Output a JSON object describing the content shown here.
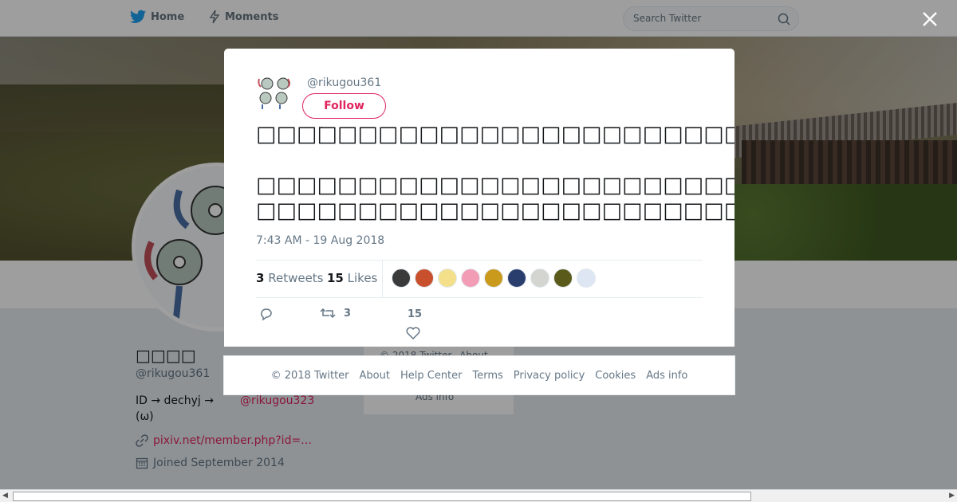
{
  "nav": {
    "home_label": "Home",
    "moments_label": "Moments",
    "search_placeholder": "Search Twitter"
  },
  "profile": {
    "name": "\u0000\u0000\u0000\u0000",
    "name_display": "□□□□",
    "handle": "@rikugou361",
    "bio_text": "ID → dechyj  →",
    "bio_second_line": "(ω)",
    "bio_mention": "@rikugou323",
    "link": "pixiv.net/member.php?id=…",
    "joined": "Joined September 2014"
  },
  "side_footer": {
    "copyright": "© 2018 Twitter",
    "about": "About",
    "ads_info": "Ads info"
  },
  "modal": {
    "handle": "@rikugou361",
    "follow_label": "Follow",
    "tweet_line1": "□□□□□□□□□□□□□□□□□□□□□□□□□□□□□□□□□□",
    "tweet_line2": "",
    "tweet_line3": "□□□□□□□□□□□□□□□□□□□□□□□□",
    "tweet_line4": "□□□□□□□□□□□□□□□□□□□□□□□□□□□□□□□□□□□□□□□□□□□□□□□□□□□□□□□□",
    "timestamp": "7:43 AM - 19 Aug 2018",
    "retweets_count": "3",
    "retweets_label": "Retweets",
    "likes_count": "15",
    "likes_label": "Likes",
    "action_retweet_count": "3",
    "action_like_count": "15",
    "liker_colors": [
      "#3a3a3a",
      "#c9502d",
      "#f4e08a",
      "#f29cb6",
      "#c99a1c",
      "#2a3e6e",
      "#d4d4d0",
      "#5a5a1a",
      "#dde6f2"
    ]
  },
  "footer": {
    "copyright": "© 2018 Twitter",
    "about": "About",
    "help": "Help Center",
    "terms": "Terms",
    "privacy": "Privacy policy",
    "cookies": "Cookies",
    "ads": "Ads info"
  },
  "colors": {
    "accent": "#e0245e",
    "brand_blue": "#1da1f2",
    "muted": "#657786"
  }
}
